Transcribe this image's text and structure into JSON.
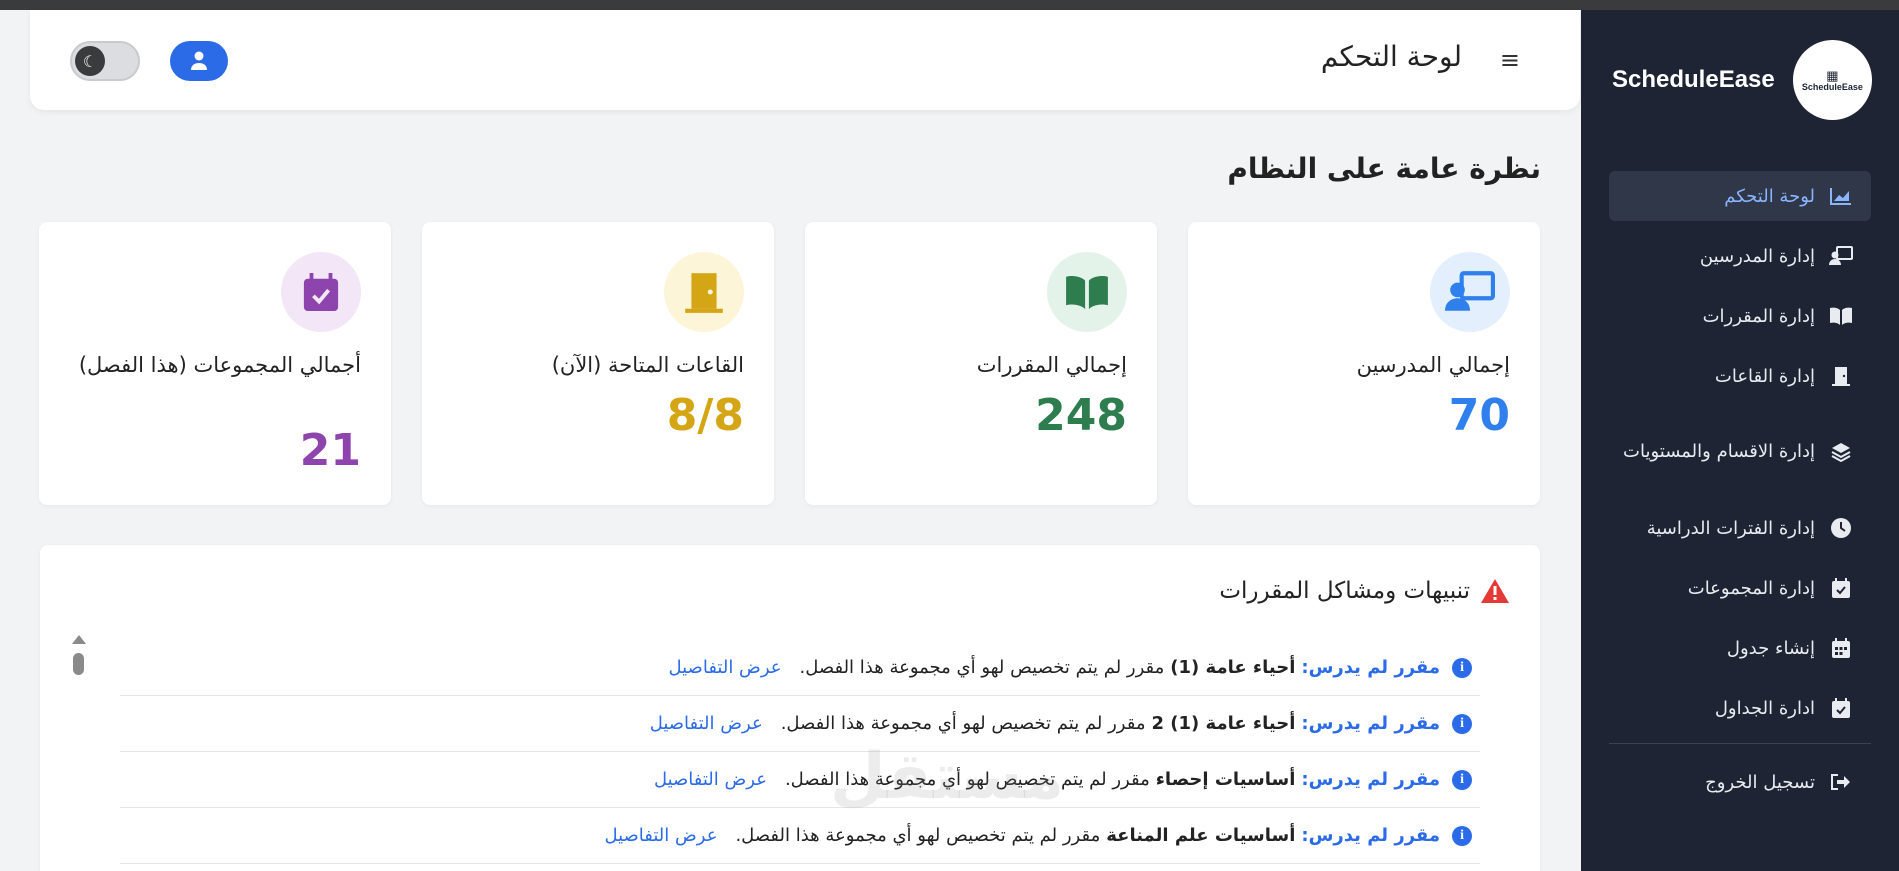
{
  "app": {
    "brand_name": "ScheduleEase",
    "logo_text": "ScheduleEase"
  },
  "header": {
    "title": "لوحة التحكم"
  },
  "sidebar": {
    "items": [
      {
        "label": "لوحة التحكم",
        "icon": "chart-area-icon",
        "active": true
      },
      {
        "label": "إدارة المدرسين",
        "icon": "teacher-icon"
      },
      {
        "label": "إدارة المقررات",
        "icon": "book-icon"
      },
      {
        "label": "إدارة القاعات",
        "icon": "door-icon"
      },
      {
        "label": "إدارة الاقسام والمستويات",
        "icon": "layers-icon"
      },
      {
        "label": "إدارة الفترات الدراسية",
        "icon": "clock-icon"
      },
      {
        "label": "إدارة المجموعات",
        "icon": "calendar-check-icon"
      },
      {
        "label": "إنشاء جدول",
        "icon": "calendar-icon"
      },
      {
        "label": "ادارة الجداول",
        "icon": "calendar-check-icon"
      }
    ],
    "logout_label": "تسجيل الخروج"
  },
  "overview": {
    "title": "نظرة عامة على النظام"
  },
  "cards": [
    {
      "label": "إجمالي المدرسين",
      "value": "70",
      "color": "#2f80ed",
      "bg": "#e3effd",
      "icon": "teacher-icon"
    },
    {
      "label": "إجمالي المقررات",
      "value": "248",
      "color": "#2e7d4f",
      "bg": "#e4f3ea",
      "icon": "book-open-icon"
    },
    {
      "label": "القاعات المتاحة (الآن)",
      "value": "8/8",
      "color": "#d4a514",
      "bg": "#fdf5d8",
      "icon": "door-icon"
    },
    {
      "label": "أجمالي المجموعات (هذا الفصل)",
      "value": "21",
      "color": "#8e44ad",
      "bg": "#f2e6f7",
      "icon": "calendar-check-icon"
    }
  ],
  "alerts": {
    "title": "تنبيهات ومشاكل المقررات",
    "rows": [
      {
        "prefix": "مقرر لم يدرس:",
        "course": "أحياء عامة (1)",
        "message": "مقرر لم يتم تخصيص لهو أي مجموعة هذا الفصل.",
        "link": "عرض التفاصيل"
      },
      {
        "prefix": "مقرر لم يدرس:",
        "course": "أحياء عامة (1) 2",
        "message": "مقرر لم يتم تخصيص لهو أي مجموعة هذا الفصل.",
        "link": "عرض التفاصيل"
      },
      {
        "prefix": "مقرر لم يدرس:",
        "course": "أساسيات إحصاء",
        "message": "مقرر لم يتم تخصيص لهو أي مجموعة هذا الفصل.",
        "link": "عرض التفاصيل"
      },
      {
        "prefix": "مقرر لم يدرس:",
        "course": "أساسيات علم المناعة",
        "message": "مقرر لم يتم تخصيص لهو أي مجموعة هذا الفصل.",
        "link": "عرض التفاصيل"
      }
    ]
  },
  "watermark": "مستقل"
}
